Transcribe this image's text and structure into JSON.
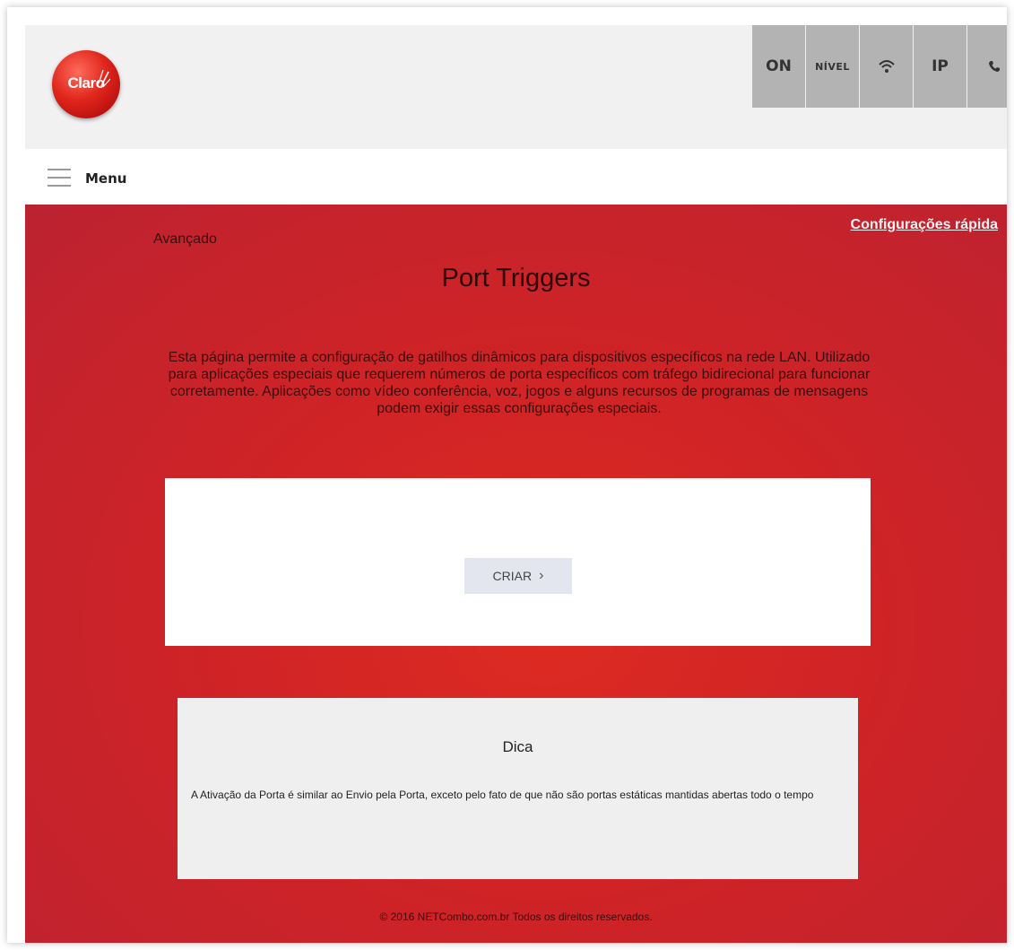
{
  "header": {
    "logo_text": "Claro",
    "status_tiles": [
      {
        "label": "ON",
        "icon": null
      },
      {
        "label": "NÍVEL",
        "icon": null
      },
      {
        "label": null,
        "icon": "wifi-icon"
      },
      {
        "label": "IP",
        "icon": null
      },
      {
        "label": null,
        "icon": "phone-icon"
      }
    ]
  },
  "menu": {
    "label": "Menu",
    "icon": "hamburger-icon"
  },
  "main": {
    "breadcrumb": "Avançado",
    "quick_link": "Configurações rápida",
    "title": "Port Triggers",
    "description": "Esta página permite a configuração de gatilhos dinâmicos para dispositivos específicos na rede LAN. Utilizado para aplicações especiais que requerem números de porta específicos com tráfego bidirecional para funcionar corretamente. Aplicações como vídeo conferência, voz, jogos e alguns recursos de programas de mensagens podem exigir essas configurações especiais.",
    "create_button": "CRIAR",
    "create_button_icon": "chevron-right-icon"
  },
  "tip": {
    "title": "Dica",
    "text": "A Ativação da Porta é similar ao Envio pela Porta, exceto pelo fato de que não são portas estáticas mantidas abertas todo o tempo"
  },
  "footer": {
    "text": "© 2016 NETCombo.com.br Todos os direitos reservados."
  },
  "colors": {
    "brand_red": "#d32624",
    "tile_gray": "#b3b3b3",
    "header_bg": "#f1f1f1",
    "button_bg": "#e4e6ef"
  }
}
